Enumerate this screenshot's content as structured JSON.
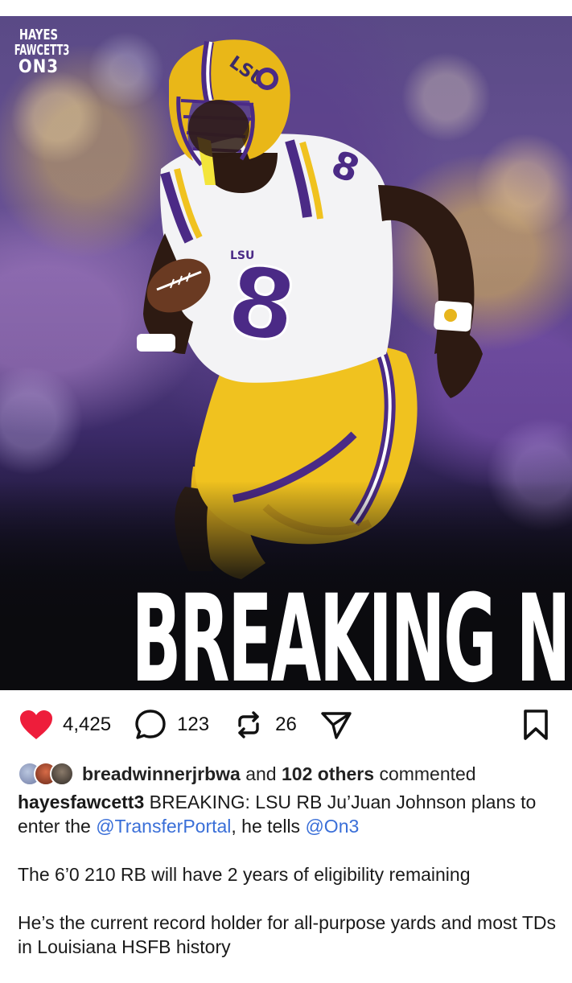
{
  "post_image": {
    "brand_line1": "HAYES",
    "brand_line2": "FAWCETT3",
    "brand_line3": "ON3",
    "jersey_number": "8",
    "helmet_text": "LSU",
    "chest_text": "LSU",
    "headline": "BREAKING NEWS"
  },
  "actions": {
    "likes": "4,425",
    "comments": "123",
    "reposts": "26"
  },
  "colors": {
    "like_red": "#ee1d3b",
    "mention_blue": "#3a6fd8"
  },
  "commented": {
    "user": "breadwinnerjrbwa",
    "connector": "and",
    "others": "102 others",
    "suffix": "commented"
  },
  "caption": {
    "username": "hayesfawcett3",
    "text_a": "BREAKING: LSU RB Ju’Juan Johnson plans to enter the",
    "mention1": "@TransferPortal",
    "text_b": ", he tells",
    "mention2": "@On3",
    "line2": "The 6’0 210 RB will have 2 years of eligibility remaining",
    "line3": "He’s the current record holder for all-purpose yards and most TDs in Louisiana HSFB history"
  }
}
